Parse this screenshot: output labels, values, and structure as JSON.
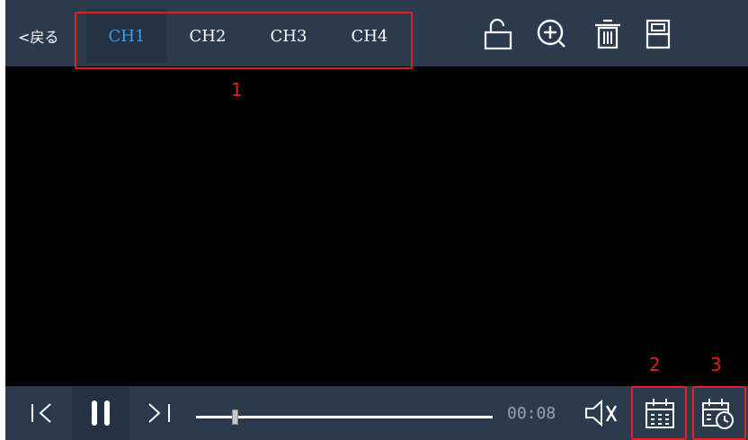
{
  "header": {
    "back_label": "<戻る",
    "channels": [
      "CH1",
      "CH2",
      "CH3",
      "CH4"
    ],
    "active_channel": "CH1",
    "tools": [
      "lock-open-icon",
      "zoom-in-icon",
      "trash-icon",
      "save-icon"
    ]
  },
  "annotations": {
    "marker_1": "1",
    "marker_2": "2",
    "marker_3": "3"
  },
  "player": {
    "time": "00:08",
    "progress": 0.12,
    "controls": [
      "previous-icon",
      "pause-icon",
      "next-icon",
      "mute-icon",
      "calendar-icon",
      "calendar-clock-icon"
    ]
  },
  "colors": {
    "bar_bg": "#2c3a4e",
    "active_tab_text": "#3aa0e6",
    "annotation": "#e02020"
  }
}
